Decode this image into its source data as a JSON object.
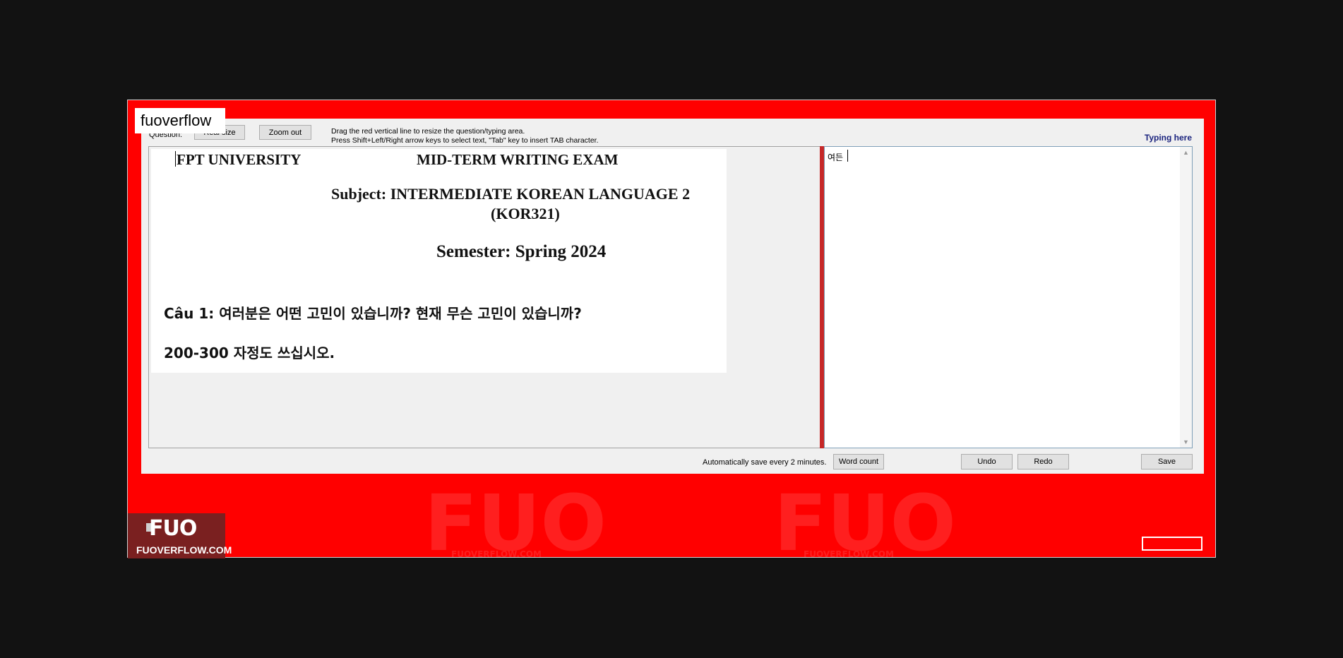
{
  "brand": "fuoverflow",
  "toolbar": {
    "question_label": "Question:",
    "real_size": "Real size",
    "zoom_out": "Zoom out",
    "help_line1": "Drag the red vertical line to resize the question/typing area.",
    "help_line2": "Press Shift+Left/Right arrow keys to select text, \"Tab\" key to insert TAB character.",
    "typing_here": "Typing here"
  },
  "question": {
    "university": "FPT UNIVERSITY",
    "exam_title": "MID-TERM WRITING EXAM",
    "subject": "Subject: INTERMEDIATE KOREAN LANGUAGE 2",
    "course_code": "(KOR321)",
    "semester": "Semester: Spring 2024",
    "q1_line1": "Câu 1: 여러분은 어떤 고민이 있습니까? 현재 무슨 고민이 있습니까?",
    "q1_line2": "200-300 자정도 쓰십시오."
  },
  "answer": {
    "text": "여든"
  },
  "footer": {
    "autosave": "Automatically save every 2 minutes.",
    "word_count": "Word count",
    "undo": "Undo",
    "redo": "Redo",
    "save": "Save"
  },
  "watermark": {
    "logo": "FUO",
    "site": "FUOVERFLOW.COM"
  },
  "colors": {
    "window_bg": "#ff0000",
    "divider": "#c62828",
    "typing_here": "#1a237e"
  }
}
